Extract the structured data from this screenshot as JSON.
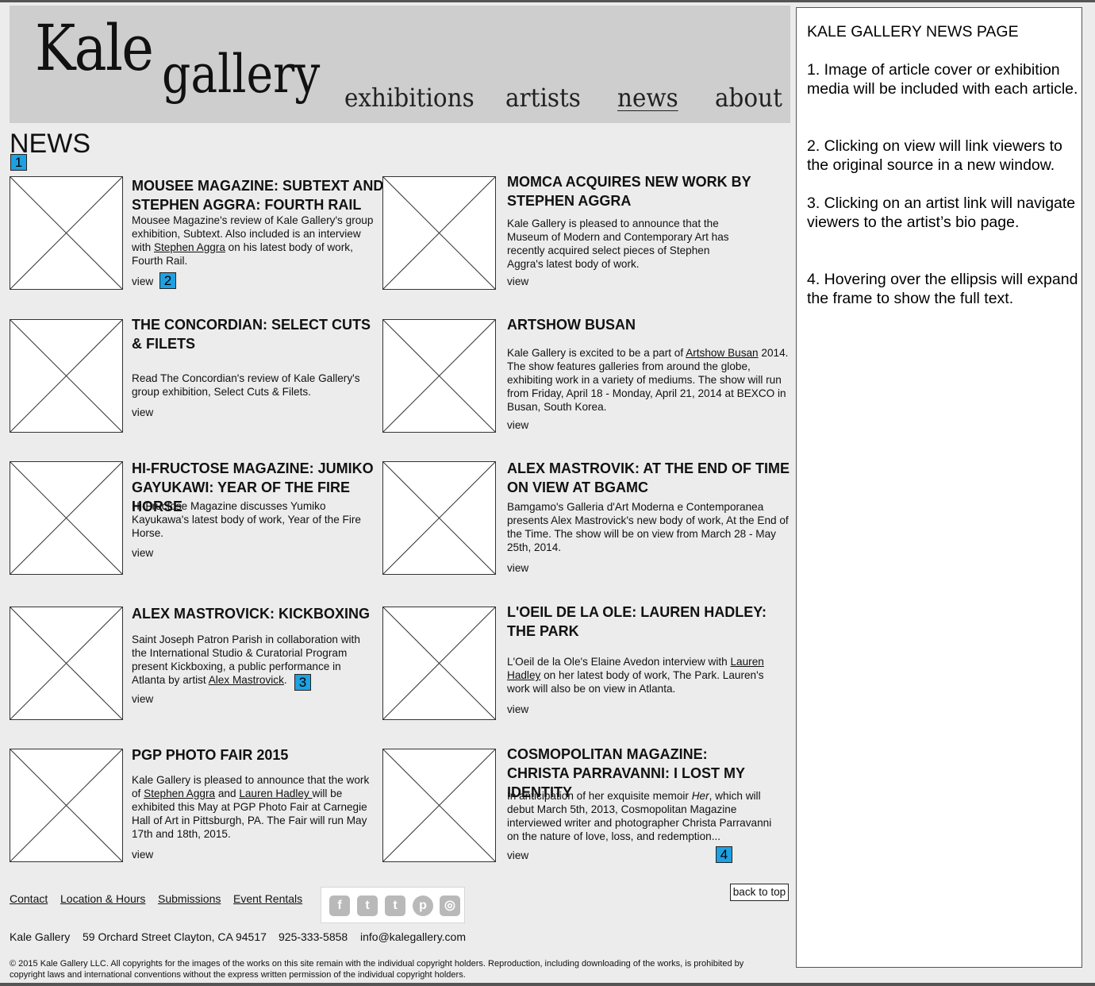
{
  "header": {
    "logo_word1": "Kale",
    "logo_word2": "gallery",
    "nav": {
      "exhibitions": "exhibitions",
      "artists": "artists",
      "news": "news",
      "about": "about"
    }
  },
  "page_title": "NEWS",
  "markers": {
    "m1": "1",
    "m2": "2",
    "m3": "3",
    "m4": "4"
  },
  "articles": [
    {
      "title": "MOUSEE MAGAZINE: SUBTEXT AND STEPHEN AGGRA: FOURTH RAIL",
      "body_pre": "Mousee Magazine's review of Kale Gallery's group exhibition, Subtext. Also included is an interview with ",
      "link": "Stephen Aggra",
      "body_post": " on his latest body of work, Fourth Rail.",
      "view": "view"
    },
    {
      "title": "MOMCA ACQUIRES NEW WORK BY STEPHEN AGGRA",
      "body": "Kale Gallery is pleased to announce that the Museum of Modern and Contemporary Art has recently acquired select pieces of Stephen Aggra's latest body of work.",
      "view": "view"
    },
    {
      "title": "THE CONCORDIAN: SELECT CUTS & FILETS",
      "body": "Read The Concordian's review of Kale Gallery's group exhibition, Select Cuts & Filets.",
      "view": "view"
    },
    {
      "title": "ARTSHOW BUSAN",
      "body_pre": "Kale Gallery is excited to be a part of ",
      "link": "Artshow Busan",
      "body_post": " 2014. The show features galleries from around the globe, exhibiting work in a variety of mediums. The show will run from Friday, April 18 - Monday, April 21, 2014 at BEXCO in Busan, South Korea.",
      "view": "view"
    },
    {
      "title": "HI-FRUCTOSE MAGAZINE: JUMIKO GAYUKAWI: YEAR OF THE FIRE HORSE",
      "body": "Hi-Fructose Magazine discusses Yumiko Kayukawa's latest body of work, Year of the Fire Horse.",
      "view": "view"
    },
    {
      "title": "ALEX MASTROVIK: AT THE END OF TIME ON VIEW AT BGAMC",
      "body": "Bamgamo's Galleria d'Art Moderna e Contemporanea presents Alex Mastrovick's new body of work, At the End of the Time. The show will be on view from March 28 - May 25th, 2014.",
      "view": "view"
    },
    {
      "title": "ALEX MASTROVICK: KICKBOXING",
      "body_pre": "Saint Joseph Patron Parish in collaboration with the International Studio & Curatorial Program present Kickboxing, a public performance in Atlanta by artist ",
      "link": "Alex Mastrovick",
      "body_post": ".",
      "view": "view"
    },
    {
      "title": "L'OEIL DE LA OLE: LAUREN HADLEY: THE PARK",
      "body_pre": "L'Oeil de la Ole's Elaine Avedon interview with ",
      "link": "Lauren Hadley",
      "body_post": " on her latest body of work, The Park. Lauren's work will also be on view in Atlanta.",
      "view": "view"
    },
    {
      "title": "PGP PHOTO FAIR 2015",
      "body_pre": "Kale Gallery is pleased to announce that the work of ",
      "link": "Stephen Aggra",
      "body_mid": "  and ",
      "link2": "Lauren Hadley ",
      "body_post": "will be exhibited this May at PGP Photo Fair at Carnegie Hall of Art in Pittsburgh, PA. The Fair will run May 17th and 18th, 2015.",
      "view": "view"
    },
    {
      "title": "COSMOPOLITAN MAGAZINE: CHRISTA PARRAVANNI: I LOST MY IDENTITY",
      "body_pre": "In anticipation of her exquisite memoir ",
      "italic": "Her",
      "body_post": ", which will debut March 5th, 2013, Cosmopolitan Magazine interviewed writer and photographer Christa Parravanni on the nature of love, loss, and redemption",
      "ellipsis": "...",
      "view": "view"
    }
  ],
  "footer": {
    "links": {
      "contact": "Contact",
      "location": "Location & Hours",
      "submissions": "Submissions",
      "rentals": "Event Rentals"
    },
    "social_icons": [
      "facebook-icon",
      "twitter-icon",
      "tumblr-icon",
      "pinterest-icon",
      "instagram-icon"
    ],
    "social_glyphs": {
      "facebook": "f",
      "twitter": "t",
      "tumblr": "t",
      "pinterest": "p",
      "instagram": "◎"
    },
    "back_to_top": "back to top",
    "address": {
      "name": "Kale Gallery",
      "street": "59 Orchard Street Clayton, CA 94517",
      "phone": "925-333-5858",
      "email": "info@kalegallery.com"
    },
    "copyright": "© 2015 Kale Gallery LLC. All copyrights for the images of the works on this site remain with the individual copyright holders. Reproduction, including downloading of the works, is prohibited by copyright laws and international conventions without the express written permission of the individual copyright holders."
  },
  "notes": {
    "title": "KALE GALLERY NEWS PAGE",
    "n1": "1. Image of article cover or exhibition media will be included with each article.",
    "n2": "2. Clicking on view will link viewers to the original source in a new window.",
    "n3": "3. Clicking on an artist link will navigate viewers to the artist’s bio page.",
    "n4": "4. Hovering over the ellipsis will expand the frame to show the full text."
  },
  "colors": {
    "header_bg": "#cecece",
    "page_bg": "#ececec",
    "marker": "#1da1e2"
  }
}
